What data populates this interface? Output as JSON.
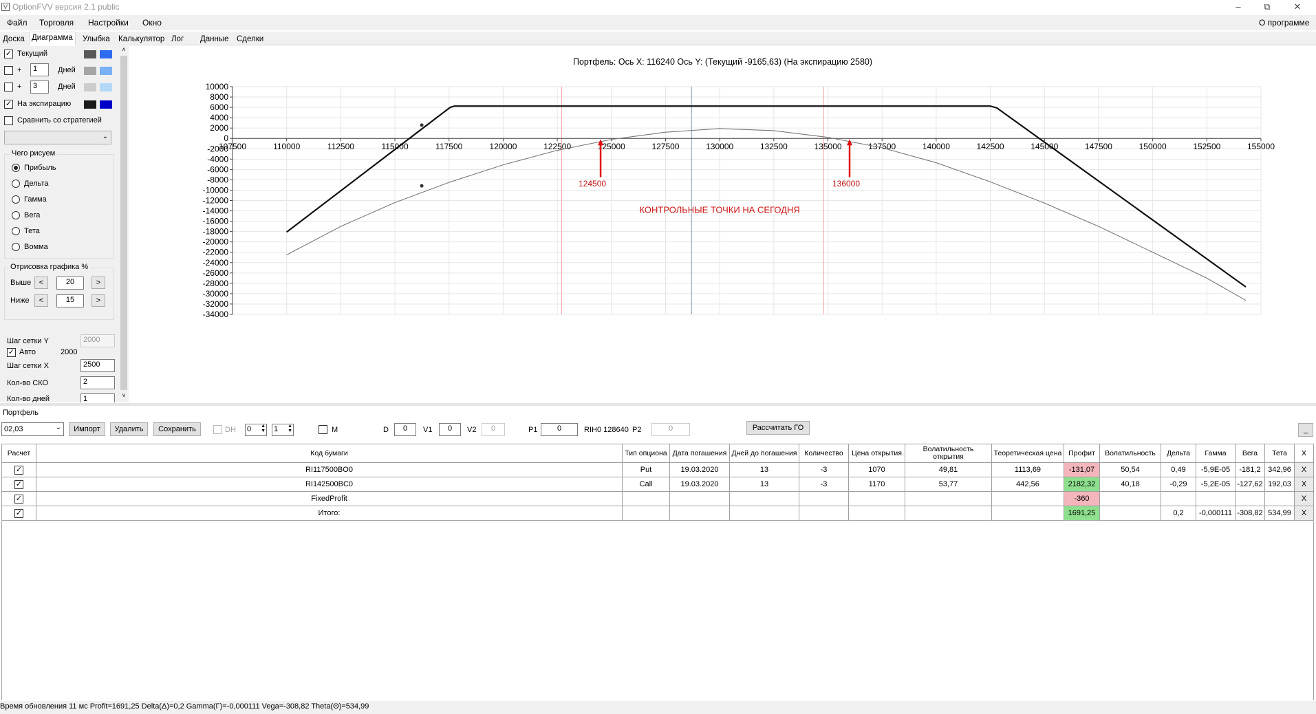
{
  "app": {
    "title": "OptionFVV версия 2.1 public"
  },
  "menu": {
    "items": [
      "Файл",
      "Торговля",
      "Настройки",
      "Окно"
    ],
    "about": "О программе"
  },
  "tabs": [
    "Доска",
    "Диаграмма",
    "Улыбка",
    "Калькулятор",
    "Лог",
    "Данные",
    "Сделки"
  ],
  "left": {
    "current_label": "Текущий",
    "plus": "+",
    "days1": "1",
    "days2": "3",
    "days_label": "Дней",
    "expiry_label": "На экспирацию",
    "compare_label": "Сравнить со стратегией",
    "draw_group": "Чего рисуем",
    "options": [
      "Прибыль",
      "Дельта",
      "Гамма",
      "Вега",
      "Тета",
      "Вомма"
    ],
    "render_group": "Отрисовка графика %",
    "above_label": "Выше",
    "above_value": "20",
    "below_label": "Ниже",
    "below_value": "15",
    "prev": "<",
    "next": ">",
    "grid_y_label": "Шаг сетки Y",
    "grid_y_value": "2000",
    "auto_label": "Авто",
    "auto_value": "2000",
    "grid_x_label": "Шаг сетки X",
    "grid_x_value": "2500",
    "sko_label": "Кол-во СКО",
    "sko_value": "2",
    "days_count_label": "Кол-во дней",
    "days_count_value": "1",
    "colors": {
      "current_dark": "#595959",
      "current_light": "#2d6bf0",
      "d1_dark": "#a6a6a6",
      "d1_light": "#7ab0f5",
      "d3_dark": "#cccccc",
      "d3_light": "#b4d8f7",
      "exp_dark": "#1a1a1a",
      "exp_light": "#0000c8"
    }
  },
  "chart_data": {
    "type": "line",
    "title": "Портфель: Ось X: 116240 Ось Y:  (Текущий -9165,63)  (На экспирацию 2580)",
    "xlim": [
      107500,
      155000
    ],
    "ylim": [
      -34000,
      10000
    ],
    "x_ticks": [
      107500,
      110000,
      112500,
      115000,
      117500,
      120000,
      122500,
      125000,
      127500,
      130000,
      132500,
      135000,
      137500,
      140000,
      142500,
      145000,
      147500,
      150000,
      152500,
      155000
    ],
    "y_ticks": [
      10000,
      8000,
      6000,
      4000,
      2000,
      0,
      -2000,
      -4000,
      -6000,
      -8000,
      -10000,
      -12000,
      -14000,
      -16000,
      -18000,
      -20000,
      -22000,
      -24000,
      -26000,
      -28000,
      -30000,
      -32000,
      -34000
    ],
    "grid": true,
    "series": [
      {
        "points": [
          [
            110000,
            -18100
          ],
          [
            117550,
            6000
          ],
          [
            117750,
            6250
          ],
          [
            142500,
            6250
          ],
          [
            142800,
            5900
          ],
          [
            154300,
            -28700
          ]
        ]
      },
      {
        "points": [
          [
            110000,
            -22500
          ],
          [
            112500,
            -17000
          ],
          [
            115000,
            -12400
          ],
          [
            117500,
            -8500
          ],
          [
            120000,
            -5100
          ],
          [
            122500,
            -2300
          ],
          [
            125000,
            -200
          ],
          [
            127500,
            1200
          ],
          [
            130000,
            1900
          ],
          [
            132500,
            1500
          ],
          [
            135000,
            200
          ],
          [
            137500,
            -1800
          ],
          [
            140000,
            -4700
          ],
          [
            142500,
            -8400
          ],
          [
            145000,
            -12500
          ],
          [
            147500,
            -17000
          ],
          [
            150000,
            -22000
          ],
          [
            152500,
            -27000
          ],
          [
            154300,
            -31300
          ]
        ]
      }
    ],
    "markers": [
      [
        116240,
        2580
      ],
      [
        116240,
        -9165.63
      ]
    ],
    "vlines_red": [
      122700,
      134800
    ],
    "vline_gray": 128700,
    "annotations": [
      {
        "text": "124500",
        "x": 124500
      },
      {
        "text": "136000",
        "x": 136000
      },
      {
        "text": "КОНТРОЛЬНЫЕ ТОЧКИ НА СЕГОДНЯ"
      }
    ]
  },
  "portfolio": {
    "label": "Портфель",
    "select": "02,03",
    "import": "Импорт",
    "delete": "Удалить",
    "save": "Сохранить",
    "dh": "DH",
    "dh_v1": "0",
    "dh_v2": "1",
    "m": "M",
    "d_label": "D",
    "d_value": "0",
    "v1_label": "V1",
    "v1_value": "0",
    "v2_label": "V2",
    "v2_value": "0",
    "p1_label": "P1",
    "p1_value": "0",
    "rih": "RIH0 128640",
    "p2_label": "P2",
    "p2_value": "0",
    "calc_go": "Рассчитать ГО",
    "min": "_"
  },
  "table": {
    "headers": [
      "Расчет",
      "Код бумаги",
      "Тип опциона",
      "Дата погашения",
      "Дней до погашения",
      "Количество",
      "Цена открытия",
      "Волатильность открытия",
      "Теоретическая цена",
      "Профит",
      "Волатильность",
      "Дельта",
      "Гамма",
      "Вега",
      "Тета",
      "X"
    ],
    "rows": [
      {
        "code": "RI117500BO0",
        "type": "Put",
        "date": "19.03.2020",
        "days": "13",
        "qty": "-3",
        "open": "1070",
        "vol_open": "49,81",
        "theor": "1113,69",
        "profit": "-131,07",
        "vol": "50,54",
        "delta": "0,49",
        "gamma": "-5,9E-05",
        "vega": "-181,2",
        "theta": "342,96",
        "x": "X"
      },
      {
        "code": "RI142500BC0",
        "type": "Call",
        "date": "19.03.2020",
        "days": "13",
        "qty": "-3",
        "open": "1170",
        "vol_open": "53,77",
        "theor": "442,56",
        "profit": "2182,32",
        "vol": "40,18",
        "delta": "-0,29",
        "gamma": "-5,2E-05",
        "vega": "-127,62",
        "theta": "192,03",
        "x": "X"
      },
      {
        "code": "FixedProfit",
        "type": "",
        "date": "",
        "days": "",
        "qty": "",
        "open": "",
        "vol_open": "",
        "theor": "",
        "profit": "-360",
        "vol": "",
        "delta": "",
        "gamma": "",
        "vega": "",
        "theta": "",
        "x": "X"
      },
      {
        "code": "Итого:",
        "type": "",
        "date": "",
        "days": "",
        "qty": "",
        "open": "",
        "vol_open": "",
        "theor": "",
        "profit": "1691,25",
        "vol": "",
        "delta": "0,2",
        "gamma": "-0,000111",
        "vega": "-308,82",
        "theta": "534,99",
        "x": "X"
      }
    ]
  },
  "status": "Время обновления 11 мс  Profit=1691,25 Delta(Δ)=0,2 Gamma(Γ)=-0,000111 Vega=-308,82 Theta(Θ)=534,99"
}
